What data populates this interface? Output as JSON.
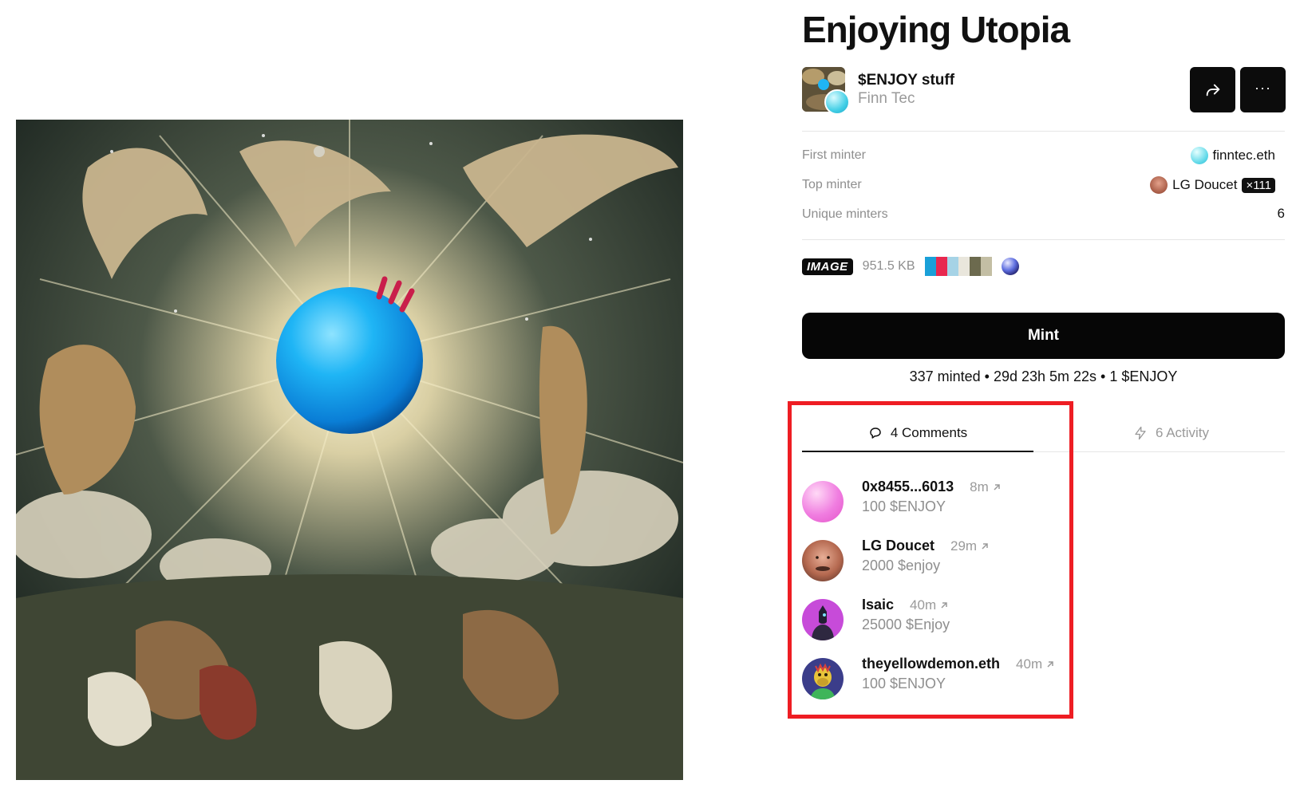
{
  "title": "Enjoying Utopia",
  "collection": {
    "name": "$ENJOY stuff",
    "creator": "Finn Tec"
  },
  "meta": {
    "first_minter_label": "First minter",
    "first_minter_value": "finntec.eth",
    "top_minter_label": "Top minter",
    "top_minter_value": "LG Doucet",
    "top_minter_count": "×111",
    "unique_minters_label": "Unique minters",
    "unique_minters_value": "6"
  },
  "media": {
    "type": "IMAGE",
    "size": "951.5 KB",
    "palette": [
      "#1aa0d8",
      "#e8284f",
      "#a6d3e6",
      "#e9e6dc",
      "#6c6a4e",
      "#c3bea4"
    ]
  },
  "mint": {
    "button_label": "Mint",
    "stats": "337 minted • 29d 23h 5m 22s • 1 $ENJOY"
  },
  "tabs": {
    "comments_label": "4 Comments",
    "activity_label": "6 Activity"
  },
  "comments": [
    {
      "user": "0x8455...6013",
      "time": "8m",
      "amount": "100 $ENJOY"
    },
    {
      "user": "LG Doucet",
      "time": "29m",
      "amount": "2000 $enjoy"
    },
    {
      "user": "Isaic",
      "time": "40m",
      "amount": "25000 $Enjoy"
    },
    {
      "user": "theyellowdemon.eth",
      "time": "40m",
      "amount": "100 $ENJOY"
    }
  ],
  "colors": {
    "accent": "#0c0c0c",
    "highlight": "#ee1d23",
    "muted_text": "#8e8e8e"
  },
  "icons": [
    "share-icon",
    "more-icon",
    "comment-icon",
    "bolt-icon",
    "external-arrow-icon"
  ]
}
